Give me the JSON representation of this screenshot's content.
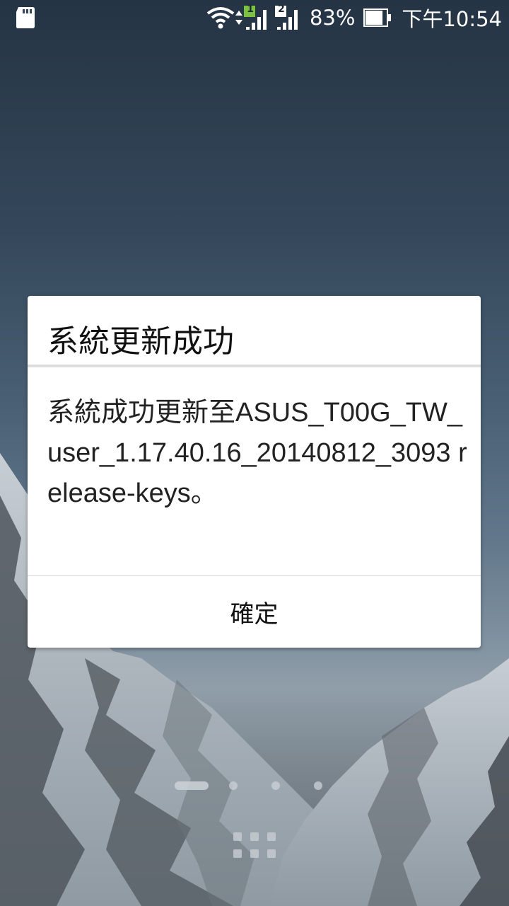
{
  "status_bar": {
    "sd_icon": "sd-card-icon",
    "wifi_icon": "wifi-icon",
    "data_icon": "data-activity-icon",
    "sim1_label": "1",
    "sim2_label": "2",
    "signal_icon": "signal-icon",
    "battery_percent": "83%",
    "battery_icon": "battery-icon",
    "battery_level": 0.83,
    "time": "下午10:54"
  },
  "dialog": {
    "title": "系統更新成功",
    "message": "系統成功更新至ASUS_T00G_TW_user_1.17.40.16_20140812_3093 release-keys。",
    "ok_label": "確定"
  },
  "launcher": {
    "page_count": 4,
    "current_page": 1,
    "apps_icon": "app-drawer-icon"
  },
  "colors": {
    "sim1_accent": "#7cc240",
    "dialog_bg": "#ffffff",
    "divider": "#dedede"
  }
}
